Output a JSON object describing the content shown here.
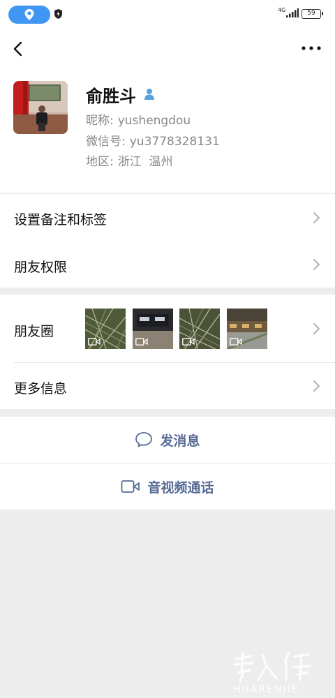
{
  "status_bar": {
    "network": "4G",
    "battery": "59",
    "icons": [
      "location-pill-icon",
      "shield-icon",
      "signal-icon",
      "battery-icon"
    ]
  },
  "nav": {
    "back_icon": "chevron-left-icon",
    "more_icon": "more-dots-icon"
  },
  "profile": {
    "name": "俞胜斗",
    "gender_icon": "person-male-icon",
    "nickname_label": "昵称:",
    "nickname": "yushengdou",
    "wechat_id_label": "微信号:",
    "wechat_id": "yu3778328131",
    "region_label": "地区:",
    "region": "浙江  温州"
  },
  "menu": {
    "remark_tags": "设置备注和标签",
    "friend_permissions": "朋友权限",
    "moments": "朋友圈",
    "more_info": "更多信息"
  },
  "actions": {
    "send_message": "发消息",
    "av_call": "音视频通话"
  },
  "colors": {
    "link_blue": "#576b95",
    "background": "#ededed",
    "accent": "#3f96f3"
  },
  "watermark": {
    "brand": "HUARENJIE"
  }
}
